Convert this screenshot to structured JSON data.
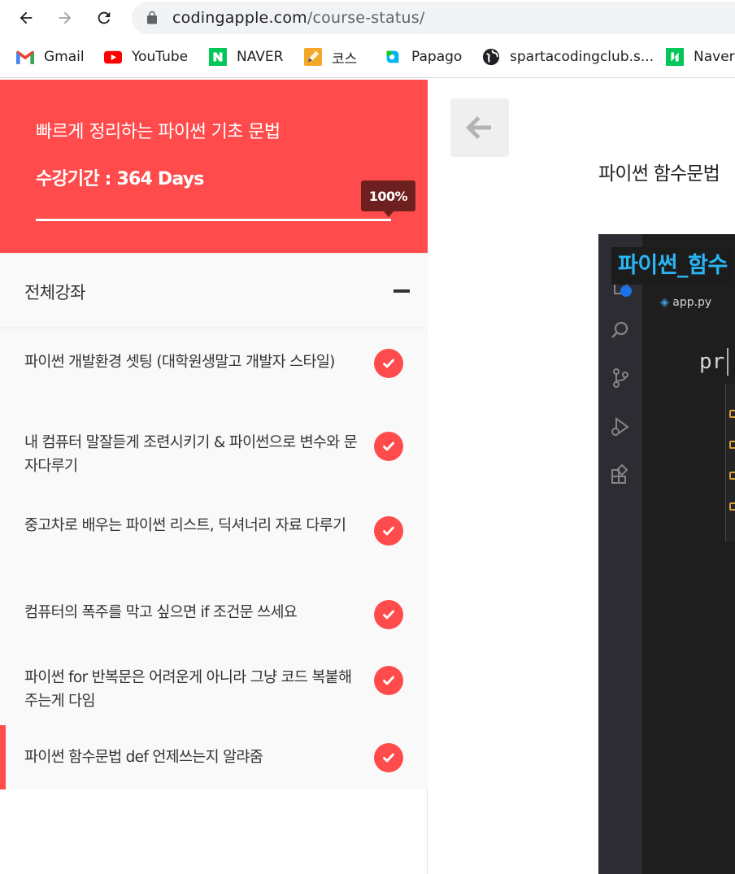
{
  "browser": {
    "url_domain": "codingapple.com",
    "url_path": "/course-status/",
    "bookmarks": [
      {
        "label": "Gmail",
        "icon": "gmail-icon"
      },
      {
        "label": "YouTube",
        "icon": "youtube-icon"
      },
      {
        "label": "NAVER",
        "icon": "naver-icon"
      },
      {
        "label": "코스",
        "icon": "pencil-icon"
      },
      {
        "label": "Papago",
        "icon": "papago-icon"
      },
      {
        "label": "spartacodingclub.s...",
        "icon": "globe-icon"
      },
      {
        "label": "Naver",
        "icon": "naver-icon"
      }
    ]
  },
  "course": {
    "title": "빠르게 정리하는 파이썬 기초 문법",
    "period": "수강기간 : 364 Days",
    "progress_label": "100%",
    "progress": 1.0
  },
  "section": {
    "title": "전체강좌"
  },
  "lessons": [
    {
      "title": "파이썬 개발환경 셋팅 (대학원생말고 개발자 스타일)",
      "completed": true
    },
    {
      "title": "내 컴퓨터 말잘듣게 조련시키기 & 파이썬으로 변수와 문자다루기",
      "completed": true
    },
    {
      "title": "중고차로 배우는 파이썬 리스트, 딕셔너리 자료 다루기",
      "completed": true
    },
    {
      "title": "컴퓨터의 폭주를 막고 싶으면 if 조건문 쓰세요",
      "completed": true
    },
    {
      "title": "파이썬 for 반복문은 어려운게 아니라 그냥 코드 복붙해주는게 다임",
      "completed": true
    },
    {
      "title": "파이썬 함수문법 def 언제쓰는지 알랴줌",
      "completed": true,
      "active": true
    }
  ],
  "content": {
    "lecture_title": "파이썬 함수문법",
    "video_overlay": "파이썬_함수",
    "editor_tab": "app.py",
    "editor_code": "pr"
  },
  "colors": {
    "accent": "#ff4b4b",
    "badge": "#6e1f1f"
  }
}
